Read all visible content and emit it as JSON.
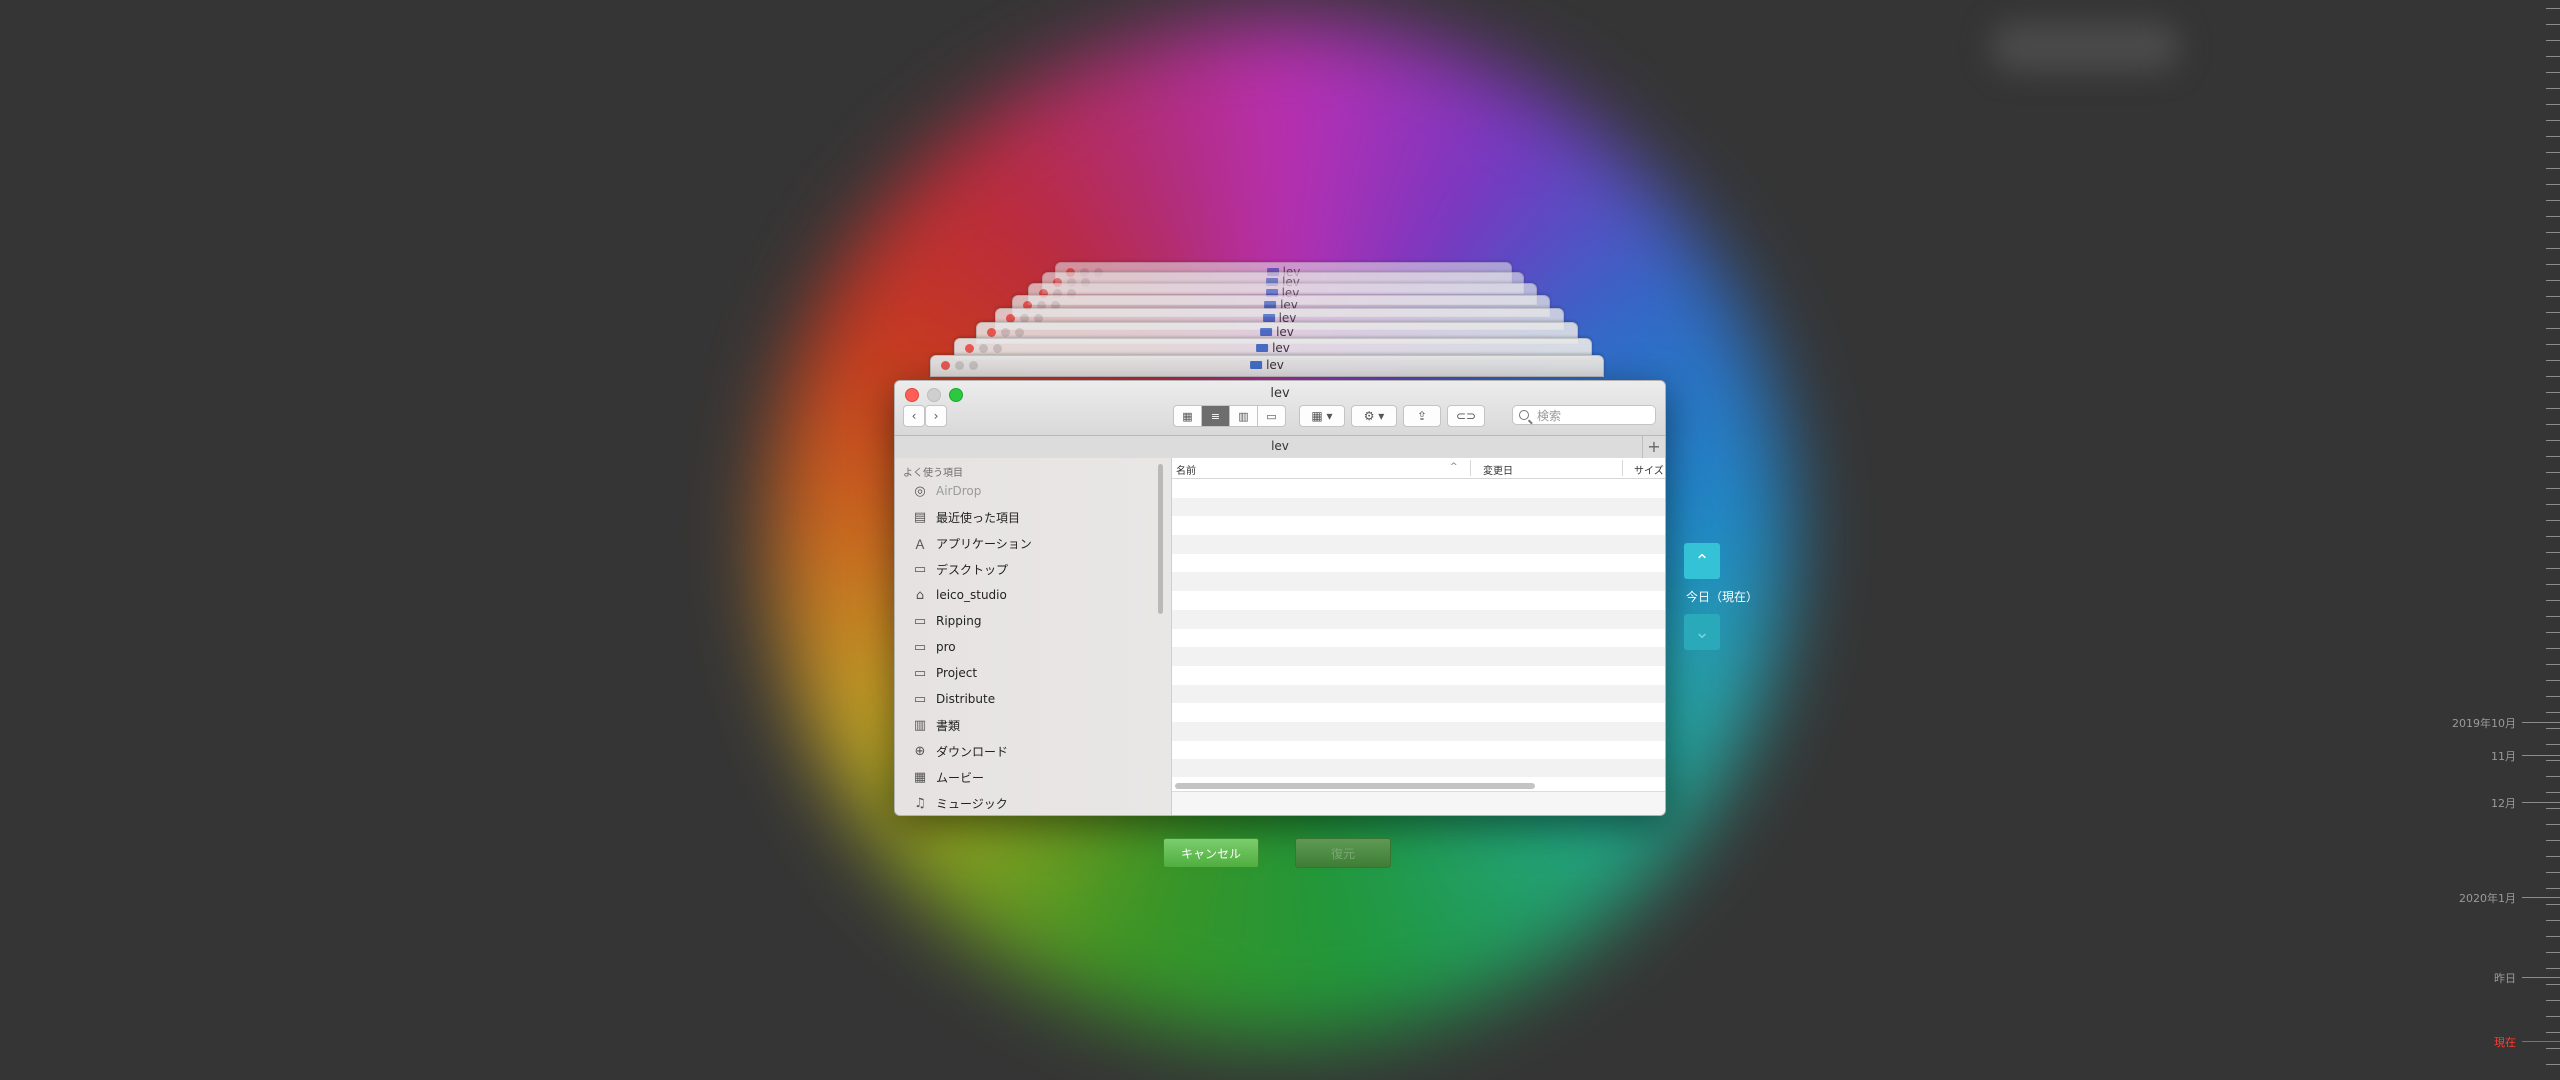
{
  "window": {
    "title": "lev",
    "path_label": "lev",
    "stack_title": "lev"
  },
  "toolbar": {
    "back_icon": "chevron-left-icon",
    "forward_icon": "chevron-right-icon",
    "view_modes": [
      "icon-view",
      "list-view",
      "column-view",
      "gallery-view"
    ],
    "active_view": "list-view",
    "search_placeholder": "検索"
  },
  "sidebar": {
    "header": "よく使う項目",
    "items": [
      {
        "label": "AirDrop",
        "icon": "airdrop-icon",
        "dim": true
      },
      {
        "label": "最近使った項目",
        "icon": "recents-icon"
      },
      {
        "label": "アプリケーション",
        "icon": "applications-icon"
      },
      {
        "label": "デスクトップ",
        "icon": "desktop-icon"
      },
      {
        "label": "leico_studio",
        "icon": "home-icon"
      },
      {
        "label": "Ripping",
        "icon": "folder-icon"
      },
      {
        "label": "pro",
        "icon": "folder-icon"
      },
      {
        "label": "Project",
        "icon": "folder-icon"
      },
      {
        "label": "Distribute",
        "icon": "folder-icon"
      },
      {
        "label": "書類",
        "icon": "documents-icon"
      },
      {
        "label": "ダウンロード",
        "icon": "downloads-icon"
      },
      {
        "label": "ムービー",
        "icon": "movies-icon"
      },
      {
        "label": "ミュージック",
        "icon": "music-icon"
      }
    ]
  },
  "columns": {
    "name": "名前",
    "modified": "変更日",
    "size": "サイズ"
  },
  "buttons": {
    "cancel": "キャンセル",
    "restore": "復元"
  },
  "navigation": {
    "current_label": "今日（現在）"
  },
  "timeline": {
    "labels": [
      {
        "text": "2019年10月"
      },
      {
        "text": "11月"
      },
      {
        "text": "12月"
      },
      {
        "text": "2020年1月"
      },
      {
        "text": "昨日"
      },
      {
        "text": "現在",
        "now": true
      }
    ]
  },
  "colors": {
    "background": "#353535",
    "accent_cyan": "#33c2d6",
    "button_green": "#4fae3f",
    "now_red": "#ff3b30"
  }
}
